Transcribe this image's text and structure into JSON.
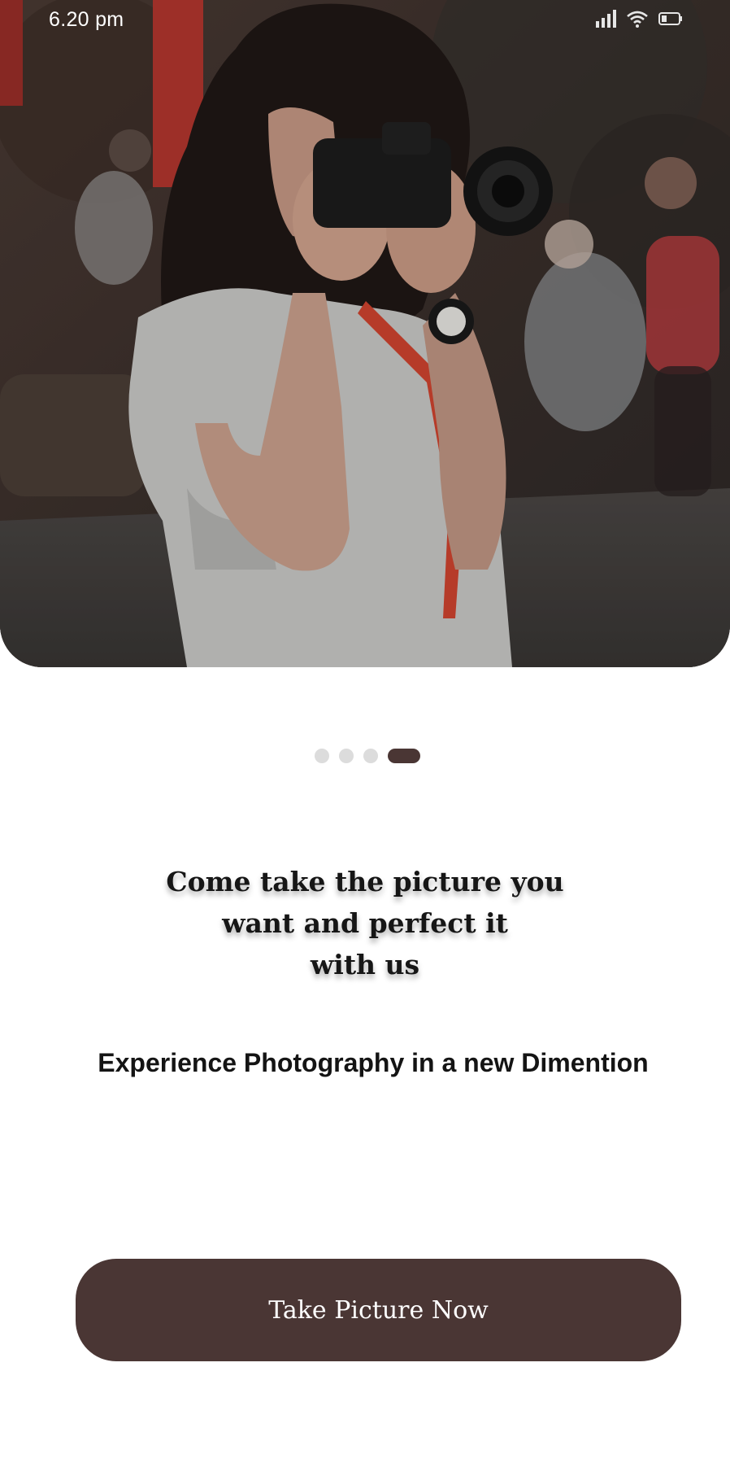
{
  "status_bar": {
    "time": "6.20 pm",
    "icons": [
      "signal-icon",
      "wifi-icon",
      "battery-icon"
    ]
  },
  "hero": {
    "image": "woman-with-camera-photo"
  },
  "pager": {
    "count": 4,
    "active_index": 3
  },
  "content": {
    "headline_lines": [
      "Come take the picture you",
      "want and perfect it",
      "with us"
    ],
    "subtitle": "Experience Photography in a new Dimention"
  },
  "cta": {
    "label": "Take Picture Now"
  },
  "colors": {
    "accent": "#4a3634",
    "dot_inactive": "#dcdcdc",
    "background": "#ffffff"
  }
}
